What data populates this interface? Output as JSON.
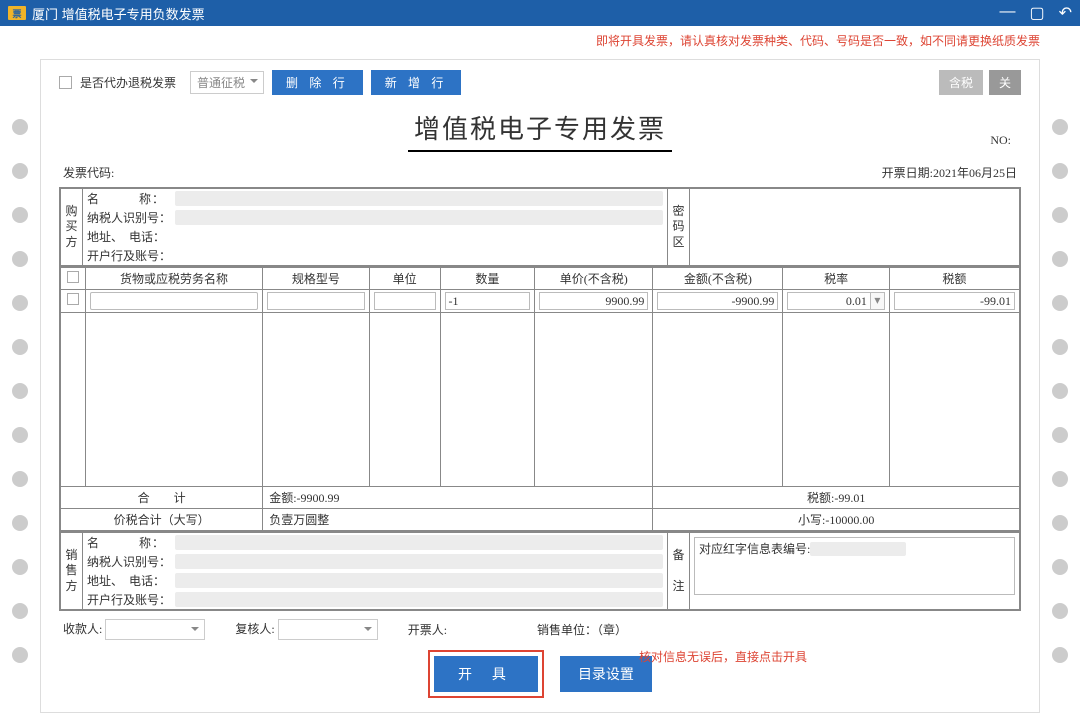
{
  "titlebar": {
    "logo": "票",
    "title": "厦门 增值税电子专用负数发票"
  },
  "warning": "即将开具发票，请认真核对发票种类、代码、号码是否一致，如不同请更换纸质发票",
  "toolbar": {
    "agent_refund": "是否代办退税发票",
    "tax_mode": "普通征税",
    "del_row": "删 除 行",
    "add_row": "新 增 行",
    "tax_incl": "含税",
    "close": "关"
  },
  "doc": {
    "title": "增值税电子专用发票",
    "no_label": "NO:",
    "no_value": "          ",
    "code_label": "发票代码:",
    "code_value": "               ",
    "date_label": "开票日期:",
    "date_value": "2021年06月25日"
  },
  "buyer": {
    "section": "购买方",
    "name_k": "名　　　称：",
    "taxid_k": "纳税人识别号：",
    "addr_k": "地址、　电话：",
    "bank_k": "开户行及账号：",
    "code_section": "密码区"
  },
  "columns": {
    "name": "货物或应税劳务名称",
    "spec": "规格型号",
    "unit": "单位",
    "qty": "数量",
    "price": "单价(不含税)",
    "amount": "金额(不含税)",
    "rate": "税率",
    "tax": "税额"
  },
  "row1": {
    "name": "                    ",
    "spec": "",
    "unit": "",
    "qty": "-1",
    "price": "9900.99",
    "amount": "-9900.99",
    "rate": "0.01",
    "tax": "-99.01"
  },
  "totals": {
    "sum_label": "合　　计",
    "amount_label": "金额:",
    "amount_value": "-9900.99",
    "tax_label": "税额:",
    "tax_value": "-99.01",
    "cn_label": "价税合计（大写）",
    "cn_value": "负壹万圆整",
    "small_label": "小写:",
    "small_value": "-10000.00"
  },
  "seller": {
    "section": "销售方",
    "name_k": "名　　　称：",
    "taxid_k": "纳税人识别号：",
    "addr_k": "地址、　电话：",
    "bank_k": "开户行及账号：",
    "note_section": "备注",
    "note_k_top": "备",
    "note_k_bot": "注",
    "note_value": "对应红字信息表编号:"
  },
  "footer": {
    "payee": "收款人:",
    "reviewer": "复核人:",
    "drawer": "开票人:",
    "drawer_val": "    ",
    "unit": "销售单位：（章）"
  },
  "actions": {
    "issue": "开 具",
    "catalog": "目录设置",
    "hint": "核对信息无误后，直接点击开具"
  }
}
